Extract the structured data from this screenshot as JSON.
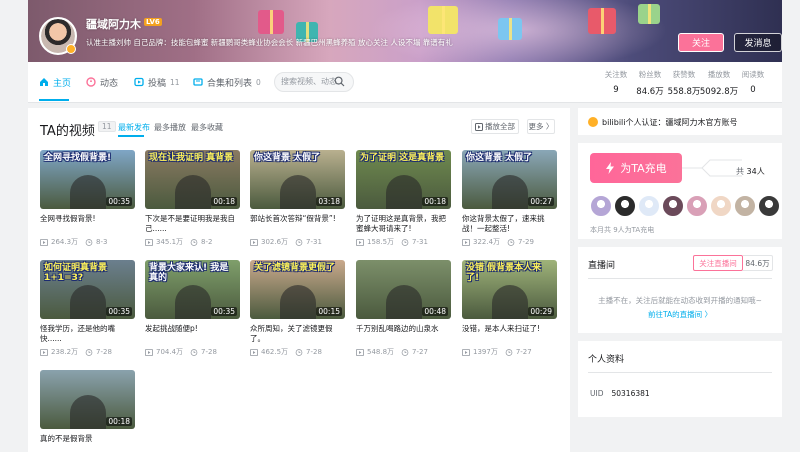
{
  "header": {
    "name": "疆域阿力木",
    "level": "LV6",
    "sign": "认准主播刘帅 自己品牌：技能包蜂蜜 新疆鹦哥类蜂业协会会长 新疆巴州黑蜂养殖 放心关注 人设不塌 靠谱有礼",
    "follow_label": "关注",
    "message_label": "发消息",
    "more_label": "⋮"
  },
  "nav": {
    "tabs": [
      {
        "label": "主页",
        "count": ""
      },
      {
        "label": "动态",
        "count": ""
      },
      {
        "label": "投稿",
        "count": "11"
      },
      {
        "label": "合集和列表",
        "count": "0"
      }
    ],
    "search_placeholder": "搜索视频、动态",
    "stats": [
      {
        "label": "关注数",
        "value": "9"
      },
      {
        "label": "粉丝数",
        "value": "84.6万"
      },
      {
        "label": "获赞数",
        "value": "558.8万"
      },
      {
        "label": "播放数",
        "value": "5092.8万"
      },
      {
        "label": "阅读数",
        "value": "0"
      }
    ]
  },
  "videos_section": {
    "title": "TA的视频",
    "count": "11",
    "sort_options": [
      "最新发布",
      "最多播放",
      "最多收藏"
    ],
    "play_all_label": "播放全部",
    "more_label": "更多 〉",
    "items": [
      {
        "caption": "全网寻找假背景!",
        "duration": "00:35",
        "title": "全网寻找假背景!",
        "plays": "264.3万",
        "date": "8-3",
        "bg": "#7fa6c6"
      },
      {
        "caption": "现在让我证明 真背景",
        "duration": "00:18",
        "title": "下次是不是要证明我是我自己......",
        "plays": "345.1万",
        "date": "8-2",
        "bg": "#8a7a62"
      },
      {
        "caption": "你这背景 太假了",
        "duration": "03:18",
        "title": "郭站长首次答辩“假背景”!",
        "plays": "302.6万",
        "date": "7-31",
        "bg": "#b9b08f"
      },
      {
        "caption": "为了证明 这是真背景",
        "duration": "00:18",
        "title": "为了证明这是真背景，我把蜜蜂大哥请来了!",
        "plays": "158.5万",
        "date": "7-31",
        "bg": "#6f8a4f"
      },
      {
        "caption": "你这背景 太假了",
        "duration": "00:27",
        "title": "你这背景太假了，速来挑战！一起整活!",
        "plays": "322.4万",
        "date": "7-29",
        "bg": "#8aa7b7"
      },
      {
        "caption": "如何证明真背景 1+1=3?",
        "duration": "00:35",
        "title": "怪我学历，还是他的嘴快......",
        "plays": "238.2万",
        "date": "7-28",
        "bg": "#6b7f8e"
      },
      {
        "caption": "背景大家来认! 我是真的",
        "duration": "00:35",
        "title": "发起挑战随便p!",
        "plays": "704.4万",
        "date": "7-28",
        "bg": "#7f9f6b"
      },
      {
        "caption": "关了滤镜背景更假了",
        "duration": "00:15",
        "title": "众所周知，关了滤镜更假了。",
        "plays": "462.5万",
        "date": "7-28",
        "bg": "#c9a98c"
      },
      {
        "caption": "",
        "duration": "00:48",
        "title": "千万别乱喝路边的山泉水",
        "plays": "548.8万",
        "date": "7-27",
        "bg": "#7c8f6a"
      },
      {
        "caption": "没错 假背景本人来了!",
        "duration": "00:29",
        "title": "没错，是本人来扫证了!",
        "plays": "1397万",
        "date": "7-27",
        "bg": "#9fb37a"
      },
      {
        "caption": "",
        "duration": "00:18",
        "title": "真的不是假背景",
        "plays": "",
        "date": "",
        "bg": "#8aa2ad"
      }
    ]
  },
  "certification": {
    "text": "bilibili个人认证：疆域阿力木官方账号"
  },
  "charge": {
    "button_label": "为TA充电",
    "total_prefix": "共",
    "total": "34人",
    "month_text": "本月共 9人为TA充电",
    "fan_colors": [
      "#b5a6d6",
      "#2b2b2b",
      "#dfe9f7",
      "#6b4a5a",
      "#d9a0b7",
      "#f0d7c5",
      "#c2b3a3",
      "#3a3a3a"
    ]
  },
  "live": {
    "title": "直播间",
    "follow_label": "关注直播间",
    "fans": "84.6万",
    "empty_text": "主播不在，关注后就能在动态收到开播的通知哦~",
    "link_label": "前往TA的直播间 〉"
  },
  "profile": {
    "title": "个人资料",
    "uid_label": "UID",
    "uid": "50316381"
  },
  "colors": {
    "accent": "#00aeec",
    "pink": "#fb7299"
  }
}
